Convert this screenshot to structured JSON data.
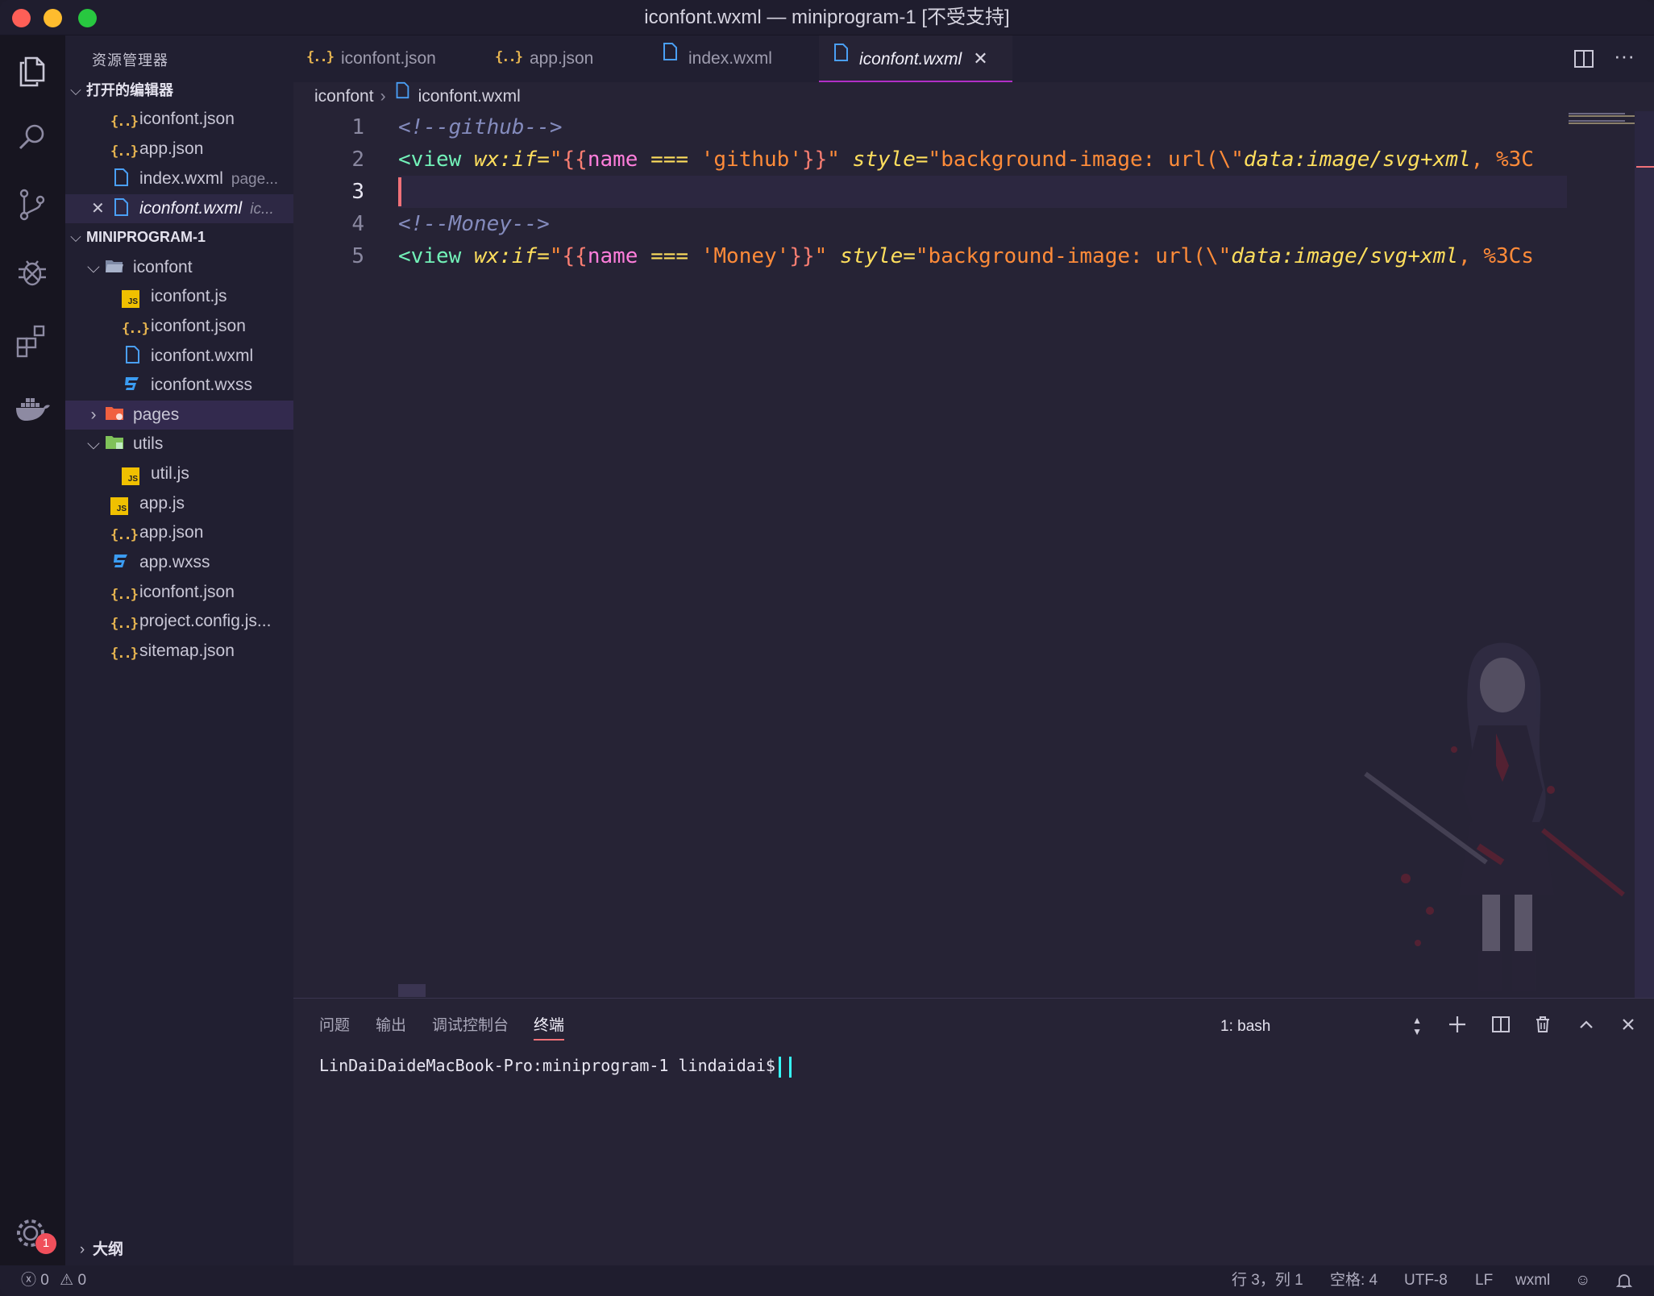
{
  "window": {
    "title": "iconfont.wxml — miniprogram-1 [不受支持]"
  },
  "activitybar": {
    "items": [
      "explorer-icon",
      "search-icon",
      "source-control-icon",
      "debug-icon",
      "extensions-icon",
      "docker-icon"
    ],
    "settings_badge": "1"
  },
  "sidebar": {
    "title": "资源管理器",
    "open_editors_label": "打开的编辑器",
    "open_editors": [
      {
        "name": "iconfont.json",
        "desc": ""
      },
      {
        "name": "app.json",
        "desc": ""
      },
      {
        "name": "index.wxml",
        "desc": "page..."
      },
      {
        "name": "iconfont.wxml",
        "desc": "ic..."
      }
    ],
    "project_label": "MINIPROGRAM-1",
    "tree": [
      {
        "name": "iconfont",
        "type": "folder-open"
      },
      {
        "name": "iconfont.js",
        "type": "js"
      },
      {
        "name": "iconfont.json",
        "type": "json"
      },
      {
        "name": "iconfont.wxml",
        "type": "file"
      },
      {
        "name": "iconfont.wxss",
        "type": "css"
      },
      {
        "name": "pages",
        "type": "folder"
      },
      {
        "name": "utils",
        "type": "folder-open"
      },
      {
        "name": "util.js",
        "type": "js"
      },
      {
        "name": "app.js",
        "type": "js"
      },
      {
        "name": "app.json",
        "type": "json"
      },
      {
        "name": "app.wxss",
        "type": "css"
      },
      {
        "name": "iconfont.json",
        "type": "json"
      },
      {
        "name": "project.config.js...",
        "type": "json"
      },
      {
        "name": "sitemap.json",
        "type": "json"
      }
    ],
    "outline_label": "大纲"
  },
  "tabs": [
    {
      "label": "iconfont.json"
    },
    {
      "label": "app.json"
    },
    {
      "label": "index.wxml"
    },
    {
      "label": "iconfont.wxml"
    }
  ],
  "breadcrumb": {
    "folder": "iconfont",
    "file": "iconfont.wxml"
  },
  "editor": {
    "line_numbers": [
      "1",
      "2",
      "3",
      "4",
      "5"
    ],
    "line1": "<!--github-->",
    "line2": {
      "tag": "<view",
      "attr": "wx:if",
      "eq": "=",
      "q1": "\"",
      "br1": "{{",
      "name": "name",
      "op": " === ",
      "str": "'github'",
      "br2": "}}",
      "q2": "\"",
      "attr2": "style",
      "eq2": "=",
      "val": "\"background-image: url(\\\"",
      "val2": "data:image/svg",
      "plus": "+",
      "val3": "xml",
      "rest": ", %3C"
    },
    "line4": "<!--Money-->",
    "line5": {
      "tag": "<view",
      "attr": "wx:if",
      "eq": "=",
      "q1": "\"",
      "br1": "{{",
      "name": "name",
      "op": " === ",
      "str": "'Money'",
      "br2": "}}",
      "q2": "\"",
      "attr2": "style",
      "eq2": "=",
      "val": "\"background-image: url(\\\"",
      "val2": "data:image/svg",
      "plus": "+",
      "val3": "xml",
      "rest": ", %3Cs"
    }
  },
  "panel": {
    "tabs": [
      "问题",
      "输出",
      "调试控制台",
      "终端"
    ],
    "terminal_select": "1: bash",
    "prompt": "LinDaiDaideMacBook-Pro:miniprogram-1 lindaidai$"
  },
  "statusbar": {
    "errors": "0",
    "warnings": "0",
    "position": "行 3，列 1",
    "spaces": "空格: 4",
    "encoding": "UTF-8",
    "eol": "LF",
    "language": "wxml"
  },
  "colors": {
    "accent": "#b12fc6",
    "caret": "#f07178",
    "terminal_cursor": "#36f9f6",
    "json_icon": "#e6b450",
    "file_icon": "#4a9ff5",
    "css_icon": "#3b9cf2",
    "js_icon": "#f0c000",
    "folder_pages": "#f06040",
    "folder_utils": "#7fc25a"
  }
}
